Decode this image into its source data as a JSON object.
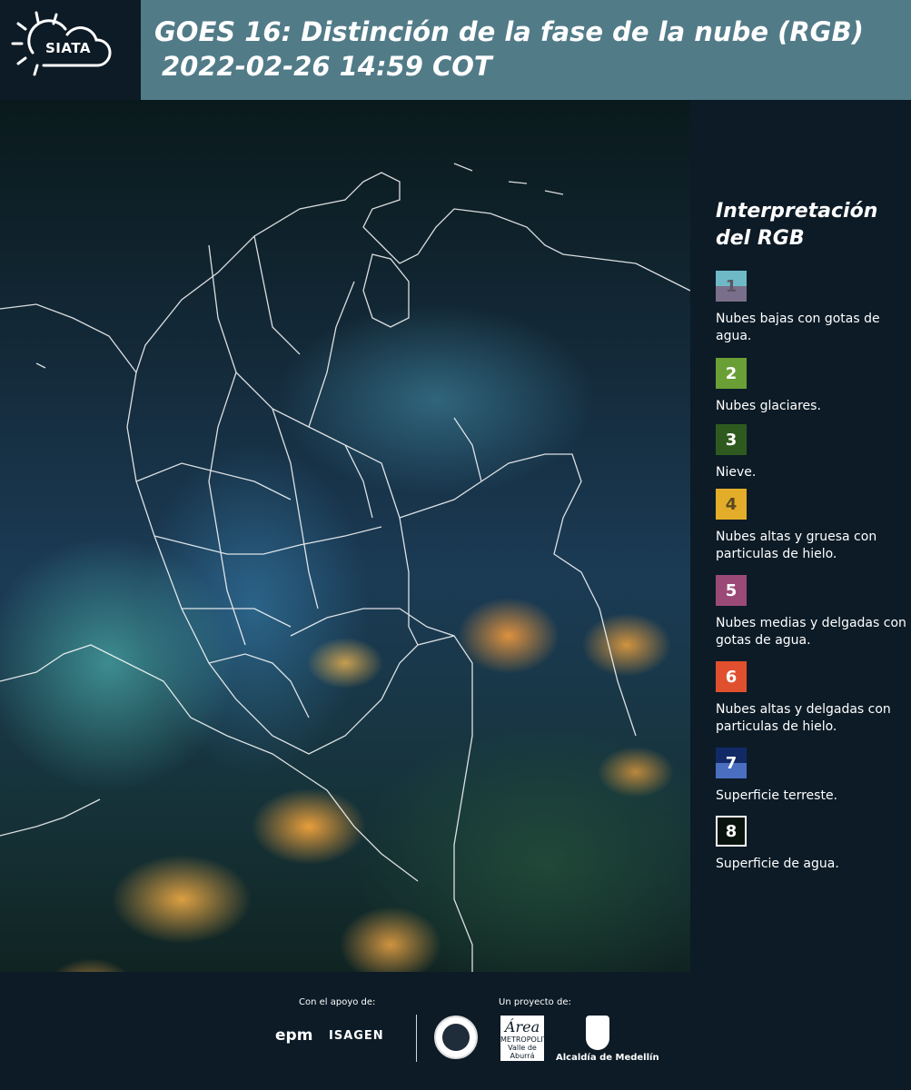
{
  "header": {
    "logo_text": "SIATA",
    "title_line1": "GOES 16: Distinción de la fase de la nube (RGB)",
    "title_line2": "2022-02-26 14:59 COT"
  },
  "legend": {
    "title_line1": "Interpretación",
    "title_line2": "del RGB",
    "items": [
      {
        "num": "1",
        "label": "Nubes bajas con gotas de agua.",
        "color_top": "#6fb9c6",
        "color_bottom": "#7a6f8a",
        "text_color": "#5b5566"
      },
      {
        "num": "2",
        "label": "Nubes glaciares.",
        "color": "#6a9f35",
        "text_color": "#ffffff"
      },
      {
        "num": "3",
        "label": "Nieve.",
        "color": "#2f5a1f",
        "text_color": "#ffffff"
      },
      {
        "num": "4",
        "label": "Nubes altas y gruesa con particulas de hielo.",
        "color": "#e3ad2a",
        "text_color": "#5b4a20"
      },
      {
        "num": "5",
        "label": "Nubes medias y delgadas con gotas de agua.",
        "color": "#9b4a78",
        "text_color": "#ffffff"
      },
      {
        "num": "6",
        "label": "Nubes altas y delgadas con particulas de hielo.",
        "color": "#e1502e",
        "text_color": "#ffffff"
      },
      {
        "num": "7",
        "label": "Superficie terreste.",
        "color_top": "#112a66",
        "color_bottom": "#4a6fc0",
        "text_color": "#ffffff"
      },
      {
        "num": "8",
        "label": "Superficie de agua.",
        "color": "#0a140f",
        "text_color": "#ffffff",
        "border": "#ffffff"
      }
    ]
  },
  "footer": {
    "support_label": "Con el apoyo de:",
    "project_label": "Un proyecto de:",
    "epm": "epm",
    "isagen": "ISAGEN",
    "area_script": "Área",
    "area_line1": "METROPOLITANA",
    "area_line2": "Valle de Aburrá",
    "alcaldia": "Alcaldía de Medellín"
  }
}
